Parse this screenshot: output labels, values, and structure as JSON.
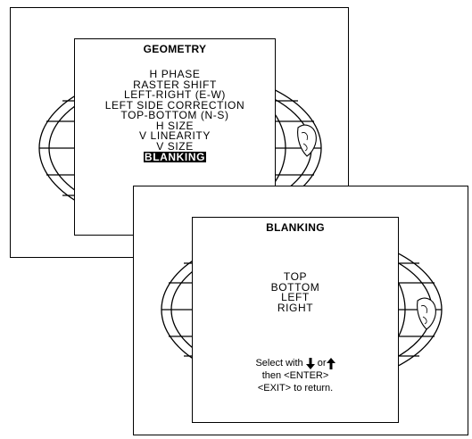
{
  "geometry_menu": {
    "title": "GEOMETRY",
    "items": [
      "H PHASE",
      "RASTER SHIFT",
      "LEFT-RIGHT (E-W)",
      "LEFT SIDE CORRECTION",
      "TOP-BOTTOM (N-S)",
      "H SIZE",
      "V LINEARITY",
      "V SIZE",
      "BLANKING"
    ],
    "selected": "BLANKING"
  },
  "blanking_menu": {
    "title": "BLANKING",
    "items": [
      "TOP",
      "BOTTOM",
      "LEFT",
      "RIGHT"
    ],
    "help": {
      "select_prefix": "Select with",
      "or_word": "or",
      "line2": "then <ENTER>",
      "line3": "<EXIT> to return."
    }
  },
  "icons": [
    "globe-grid-icon",
    "down-arrow-icon",
    "up-arrow-icon"
  ]
}
